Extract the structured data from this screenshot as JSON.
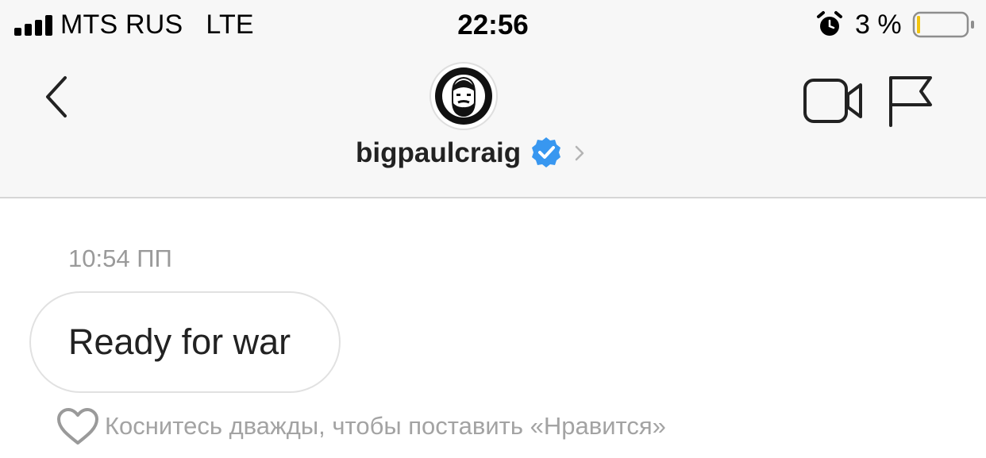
{
  "status_bar": {
    "carrier": "MTS RUS",
    "network": "LTE",
    "time": "22:56",
    "battery_percent": "3 %",
    "battery_level": 0.03,
    "icons": [
      "signal-bars-icon",
      "alarm-icon",
      "battery-icon"
    ]
  },
  "header": {
    "username": "bigpaulcraig",
    "verified": true,
    "icons": [
      "back-chevron-icon",
      "verified-badge-icon",
      "chevron-right-icon",
      "video-camera-icon",
      "flag-icon"
    ],
    "colors": {
      "verified_badge": "#3897f0",
      "header_bg": "#f7f7f7"
    }
  },
  "conversation": {
    "timestamp": "10:54 ПП",
    "messages": [
      {
        "text": "Ready for war"
      }
    ],
    "like_hint": "Коснитесь дважды, чтобы поставить «Нравится»",
    "like_icon": "heart-outline-icon"
  }
}
